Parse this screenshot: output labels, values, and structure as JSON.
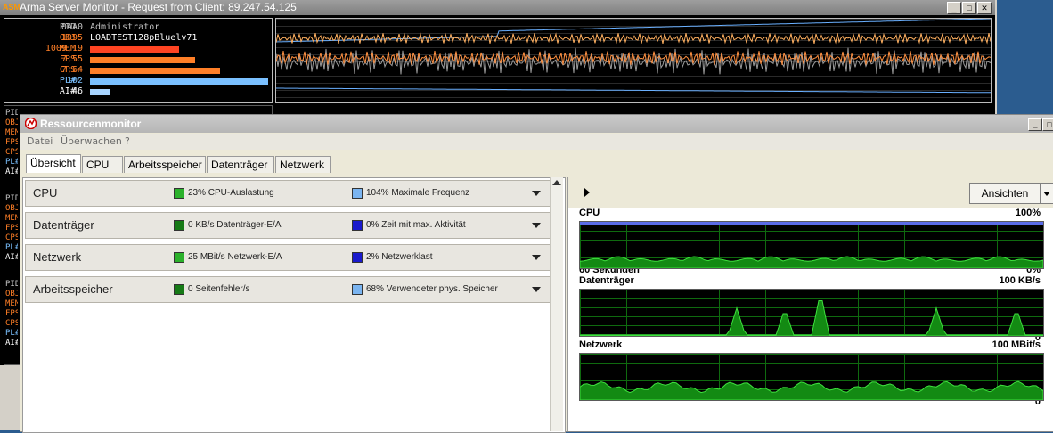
{
  "asm": {
    "logo": "ASM",
    "title": "Arma Server Monitor - Request from Client: 89.247.54.125",
    "window_buttons": [
      "_",
      "□",
      "✕"
    ],
    "stats": [
      {
        "label": "PID:",
        "value": "0AA0",
        "color": "#c0c0c0",
        "bar": 0
      },
      {
        "label": "OBJ:",
        "value": "1095",
        "color": "#ff7f27",
        "bar": 0
      },
      {
        "label": "MEM:",
        "value": "1009,19",
        "color": "#ff7f27",
        "bar": 0.5
      },
      {
        "label": "FPS:",
        "value": "7,55",
        "color": "#ff7f27",
        "bar": 0.59
      },
      {
        "label": "CPS:",
        "value": "7,64",
        "color": "#ff7f27",
        "bar": 0.73
      },
      {
        "label": "PL#:",
        "value": "102",
        "color": "#7ac0ff",
        "bar": 1.0
      },
      {
        "label": "AI#:",
        "value": "46",
        "color": "#ffffff",
        "bar": 0.11
      }
    ],
    "info_user": "Administrator",
    "info_mission": "LOADTEST128pBluelv71",
    "left_labels": [
      "PID",
      "OBJ",
      "MEM",
      "FPS",
      "CPS",
      "PL#",
      "AI#"
    ]
  },
  "rm": {
    "title": "Ressourcenmonitor",
    "menu": [
      "Datei",
      "Überwachen",
      "?"
    ],
    "tabs": [
      "Übersicht",
      "CPU",
      "Arbeitsspeicher",
      "Datenträger",
      "Netzwerk"
    ],
    "active_tab": 0,
    "sections": [
      {
        "name": "CPU",
        "stat1": "23% CPU-Auslastung",
        "stat1_color": "#2bb12b",
        "stat2": "104% Maximale Frequenz",
        "stat2_color": "#7ab4f0"
      },
      {
        "name": "Datenträger",
        "stat1": "0 KB/s Datenträger-E/A",
        "stat1_color": "#167a16",
        "stat2": "0% Zeit mit max. Aktivität",
        "stat2_color": "#1a1acc"
      },
      {
        "name": "Netzwerk",
        "stat1": "25 MBit/s Netzwerk-E/A",
        "stat1_color": "#2bb12b",
        "stat2": "2% Netzwerklast",
        "stat2_color": "#1a1acc"
      },
      {
        "name": "Arbeitsspeicher",
        "stat1": "0 Seitenfehler/s",
        "stat1_color": "#167a16",
        "stat2": "68% Verwendeter phys. Speicher",
        "stat2_color": "#7ab4f0"
      }
    ],
    "view_button": "Ansichten",
    "graphs": [
      {
        "name": "CPU",
        "max": "100%",
        "foot_left": "60 Sekunden",
        "foot_right": "0%"
      },
      {
        "name": "Datenträger",
        "max": "100 KB/s",
        "foot_left": "",
        "foot_right": "0"
      },
      {
        "name": "Netzwerk",
        "max": "100 MBit/s",
        "foot_left": "",
        "foot_right": "0"
      }
    ]
  }
}
